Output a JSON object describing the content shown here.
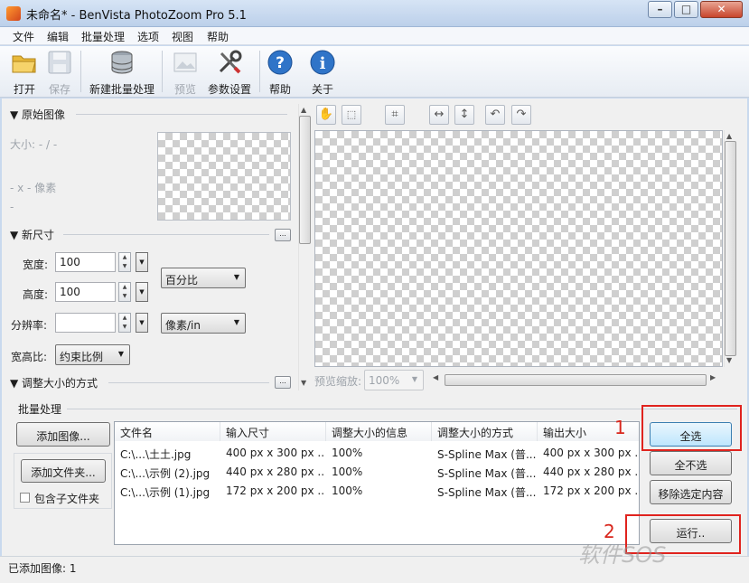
{
  "window": {
    "title": "未命名* - BenVista PhotoZoom Pro 5.1"
  },
  "menu": [
    "文件",
    "编辑",
    "批量处理",
    "选项",
    "视图",
    "帮助"
  ],
  "toolbar": {
    "open": "打开",
    "save": "保存",
    "new_batch": "新建批量处理",
    "preview": "预览",
    "settings": "参数设置",
    "help": "帮助",
    "about": "关于"
  },
  "original": {
    "header": "▼ 原始图像",
    "size": "大小: - / -",
    "dims": "- x - 像素",
    "dash": "-"
  },
  "new_size": {
    "header": "▼ 新尺寸",
    "more": "...",
    "width_label": "宽度:",
    "width_value": "100",
    "height_label": "高度:",
    "height_value": "100",
    "res_label": "分辨率:",
    "res_value": "",
    "unit_wh": "百分比",
    "unit_res": "像素/in",
    "aspect_label": "宽高比:",
    "aspect_value": "约束比例"
  },
  "resize_method": {
    "header": "▼ 调整大小的方式",
    "more": "..."
  },
  "preview": {
    "zoom_label": "预览缩放:",
    "zoom_value": "100%"
  },
  "batch": {
    "header": "批量处理",
    "add_images": "添加图像...",
    "add_folder": "添加文件夹...",
    "include_subfolders": "包含子文件夹",
    "columns": [
      "文件名",
      "输入尺寸",
      "调整大小的信息",
      "调整大小的方式",
      "输出大小"
    ],
    "rows": [
      [
        "C:\\...\\土土.jpg",
        "400 px x 300 px ...",
        "100%",
        "S-Spline Max (普...",
        "400 px x 300 px ..."
      ],
      [
        "C:\\...\\示例 (2).jpg",
        "440 px x 280 px ...",
        "100%",
        "S-Spline Max (普...",
        "440 px x 280 px ..."
      ],
      [
        "C:\\...\\示例 (1).jpg",
        "172 px x 200 px ...",
        "100%",
        "S-Spline Max (普...",
        "172 px x 200 px ..."
      ]
    ],
    "select_all": "全选",
    "select_none": "全不选",
    "remove_selected": "移除选定内容",
    "run": "运行.."
  },
  "annotations": {
    "one": "1",
    "two": "2"
  },
  "status": "已添加图像: 1",
  "watermark": "软件SOS",
  "colors": {
    "highlight": "#e0231e",
    "accent_blue": "#2f74c8"
  }
}
